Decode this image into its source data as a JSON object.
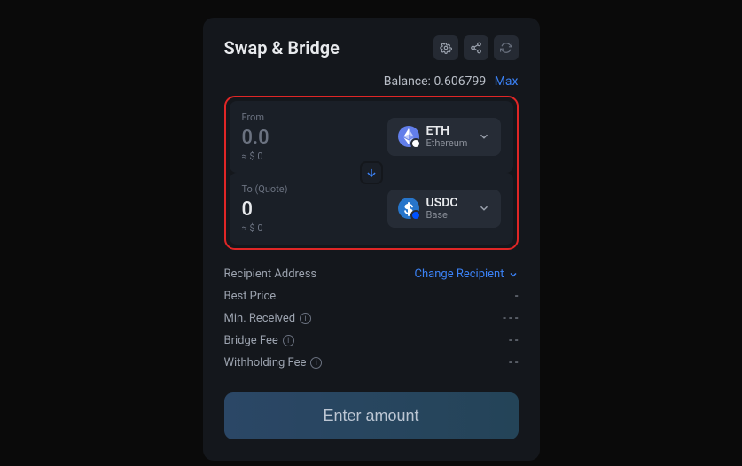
{
  "title": "Swap & Bridge",
  "balance": {
    "label": "Balance:",
    "value": "0.606799",
    "max": "Max"
  },
  "from": {
    "label": "From",
    "amount": "0.0",
    "fiat": "≈ $ 0",
    "token": {
      "symbol": "ETH",
      "network": "Ethereum"
    }
  },
  "to": {
    "label": "To (Quote)",
    "amount": "0",
    "fiat": "≈ $ 0",
    "token": {
      "symbol": "USDC",
      "network": "Base"
    }
  },
  "details": {
    "recipient": {
      "label": "Recipient Address",
      "action": "Change Recipient"
    },
    "bestPrice": {
      "label": "Best Price",
      "value": "-"
    },
    "minReceived": {
      "label": "Min. Received",
      "value": "- - -"
    },
    "bridgeFee": {
      "label": "Bridge Fee",
      "value": "- -"
    },
    "withholdingFee": {
      "label": "Withholding Fee",
      "value": "- -"
    }
  },
  "submit": "Enter amount"
}
